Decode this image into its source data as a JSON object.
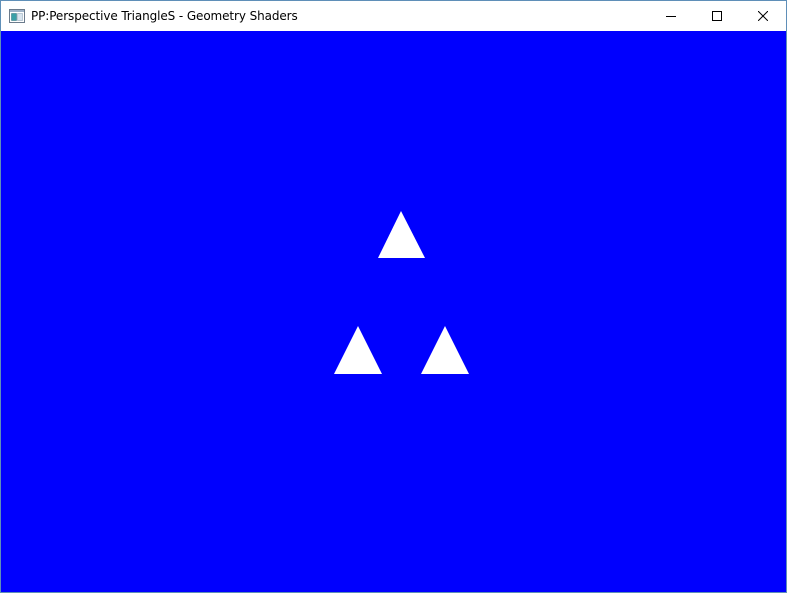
{
  "window": {
    "title": "PP:Perspective TriangleS - Geometry Shaders",
    "icon": "application-window-icon",
    "controls": {
      "minimize": "minimize-icon",
      "maximize": "maximize-icon",
      "close": "close-icon"
    }
  },
  "viewport": {
    "background_color": "#0000fe",
    "shape_color": "#ffffff",
    "shapes": [
      "triangle",
      "triangle",
      "triangle"
    ]
  }
}
